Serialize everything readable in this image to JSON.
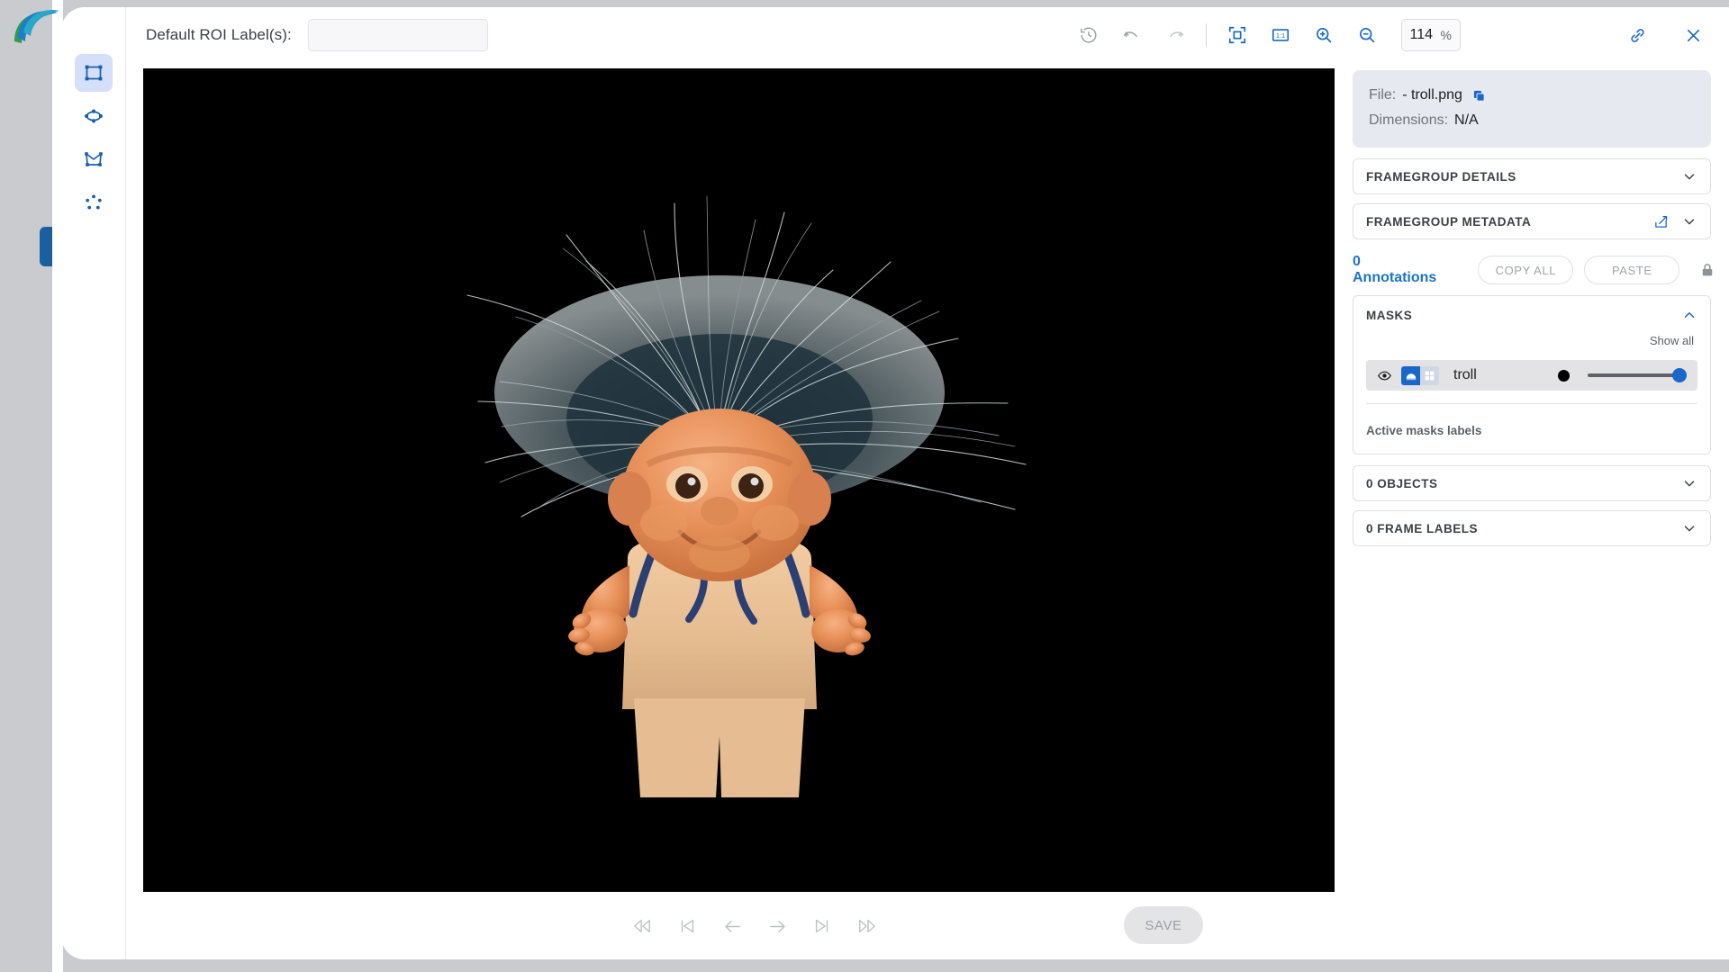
{
  "app": {
    "logo_name": "app-logo",
    "accent_blue": "#1967c9",
    "link_blue": "#1a73c7",
    "canvas_background": "#000000"
  },
  "toolbar_left": {
    "tools": [
      {
        "id": "bounding-box-tool",
        "icon": "bounding-box-icon",
        "active": true
      },
      {
        "id": "ellipse-tool",
        "icon": "ellipse-icon",
        "active": false
      },
      {
        "id": "polygon-tool",
        "icon": "polygon-icon",
        "active": false
      },
      {
        "id": "keypoints-tool",
        "icon": "keypoints-icon",
        "active": false
      }
    ]
  },
  "top_bar": {
    "roi_label_text": "Default ROI Label(s):",
    "roi_label_value": "",
    "roi_label_placeholder": "",
    "canvas_tools": [
      {
        "id": "history-button",
        "icon": "history-icon"
      },
      {
        "id": "undo-button",
        "icon": "undo-icon"
      },
      {
        "id": "redo-button",
        "icon": "redo-icon"
      }
    ],
    "zoom_tools": [
      {
        "id": "fit-to-screen-button",
        "icon": "fit-to-screen-icon"
      },
      {
        "id": "actual-size-button",
        "icon": "one-to-one-icon"
      },
      {
        "id": "zoom-in-button",
        "icon": "zoom-in-icon"
      },
      {
        "id": "zoom-out-button",
        "icon": "zoom-out-icon"
      }
    ],
    "zoom_value": "114",
    "zoom_unit": "%",
    "window_actions": [
      {
        "id": "copy-link-button",
        "icon": "link-icon"
      },
      {
        "id": "close-button",
        "icon": "close-icon"
      }
    ]
  },
  "canvas": {
    "image_subject": "troll-doll-photo"
  },
  "bottom_bar": {
    "nav_buttons": [
      {
        "id": "rewind-button",
        "icon": "rewind-icon"
      },
      {
        "id": "first-frame-button",
        "icon": "skip-to-start-icon"
      },
      {
        "id": "previous-frame-button",
        "icon": "arrow-left-icon"
      },
      {
        "id": "next-frame-button",
        "icon": "arrow-right-icon"
      },
      {
        "id": "last-frame-button",
        "icon": "skip-to-end-icon"
      },
      {
        "id": "fast-forward-button",
        "icon": "fast-forward-icon"
      }
    ],
    "save_label": "SAVE"
  },
  "right_panel": {
    "file_label": "File:",
    "file_name": "- troll.png",
    "copy_icon": "copy-icon",
    "dimensions_label": "Dimensions:",
    "dimensions_value": "N/A",
    "accordions": [
      {
        "id": "framegroup-details",
        "title": "FRAMEGROUP DETAILS",
        "has_edit": false,
        "expanded": false
      },
      {
        "id": "framegroup-metadata",
        "title": "FRAMEGROUP METADATA",
        "has_edit": true,
        "expanded": false
      }
    ],
    "annotations": {
      "count_label": "0 Annotations",
      "copy_all_label": "COPY ALL",
      "paste_label": "PASTE",
      "lock_icon": "lock-icon",
      "visibility_icon": "eye-icon"
    },
    "masks": {
      "title": "MASKS",
      "expanded": true,
      "show_all_label": "Show all",
      "rows": [
        {
          "name": "troll",
          "visible": true,
          "visibility_icon": "eye-icon",
          "fill_mode_icon": "mask-fill-icon",
          "pattern_mode_icon": "mask-pattern-icon",
          "color": "#000000",
          "opacity": 100
        }
      ],
      "active_masks_labels": "Active masks labels"
    },
    "bottom_accordions": [
      {
        "id": "objects",
        "title": "0 OBJECTS",
        "expanded": false
      },
      {
        "id": "frame-labels",
        "title": "0 FRAME LABELS",
        "expanded": false
      }
    ]
  }
}
